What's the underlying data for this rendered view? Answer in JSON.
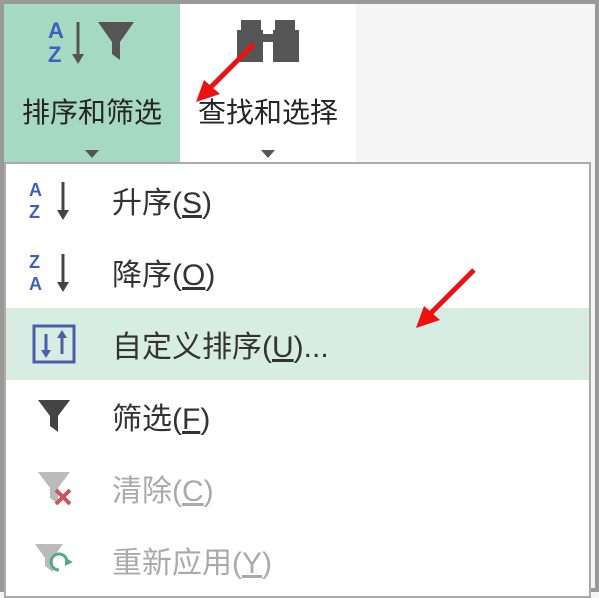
{
  "ribbon": {
    "sort_filter": {
      "label": "排序和筛选"
    },
    "find_select": {
      "label": "查找和选择"
    }
  },
  "menu": {
    "asc": {
      "label": "升序",
      "mnemonic": "S"
    },
    "desc": {
      "label": "降序",
      "mnemonic": "O"
    },
    "custom": {
      "label": "自定义排序",
      "mnemonic": "U",
      "suffix": "..."
    },
    "filter": {
      "label": "筛选",
      "mnemonic": "F"
    },
    "clear": {
      "label": "清除",
      "mnemonic": "C"
    },
    "reapply": {
      "label": "重新应用",
      "mnemonic": "Y"
    }
  }
}
